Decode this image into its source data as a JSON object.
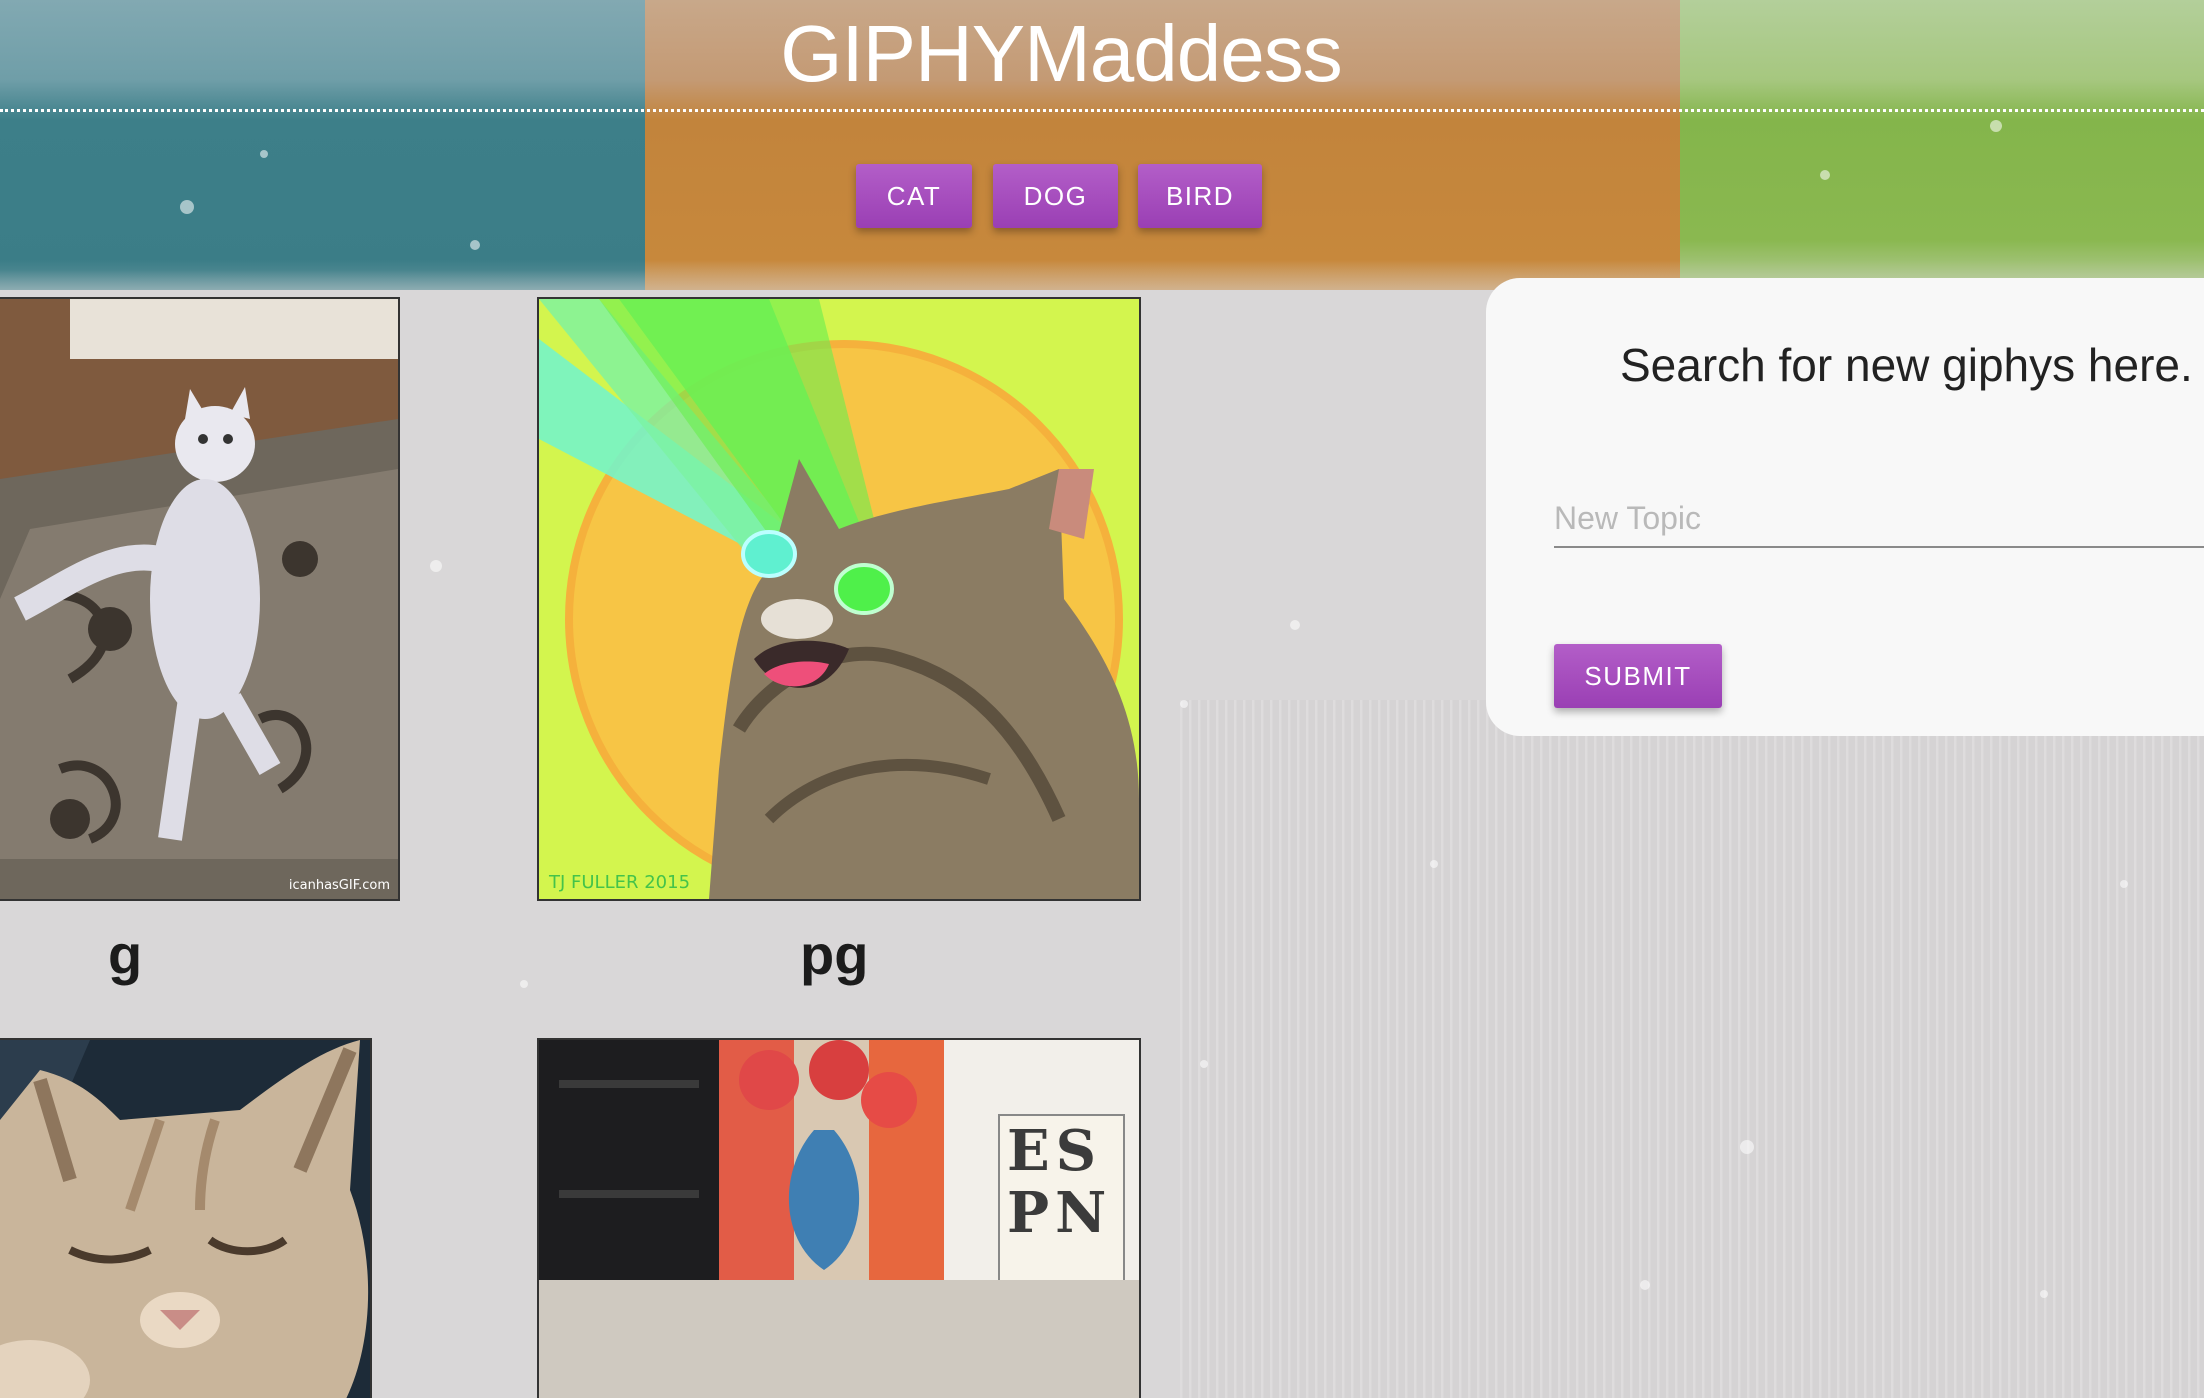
{
  "header": {
    "title": "GIPHYMaddess"
  },
  "topics": [
    {
      "label": "CAT"
    },
    {
      "label": "DOG"
    },
    {
      "label": "BIRD"
    }
  ],
  "gifs": [
    {
      "subject": "white cat dancing on rug",
      "rating": "g"
    },
    {
      "subject": "laser-eyes cat on yellow background",
      "rating": "pg"
    },
    {
      "subject": "sleepy kitten"
    },
    {
      "subject": "room with vase painting and ESPN book"
    }
  ],
  "gif_captions": {
    "gif1_watermark": "icanhasGIF.com",
    "gif2_watermark": "TJ FULLER 2015",
    "gif4_book": "ES PN"
  },
  "search": {
    "title": "Search for new giphys here.",
    "placeholder": "New Topic",
    "value": "",
    "submit_label": "SUBMIT"
  },
  "colors": {
    "button": "#a54dbd",
    "stripe_teal": "#3d7f89",
    "stripe_orange": "#c2843c",
    "stripe_green": "#84b54b"
  }
}
